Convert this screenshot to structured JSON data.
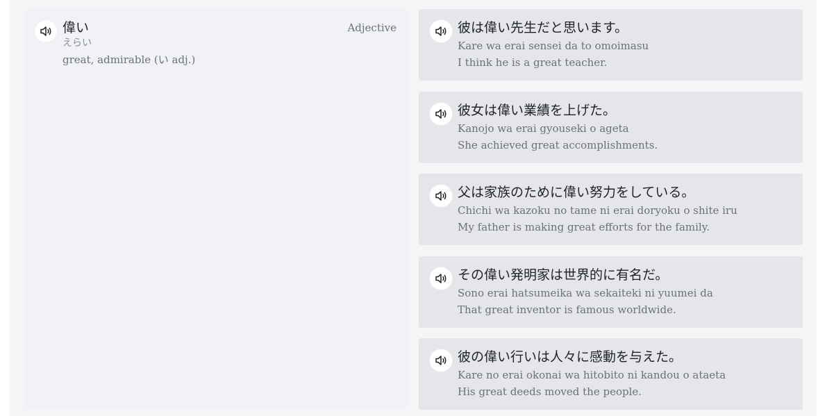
{
  "word": {
    "kanji": "偉い",
    "reading": "えらい",
    "meaning": "great, admirable (い adj.)",
    "part_of_speech": "Adjective",
    "audio_icon": "speaker-icon"
  },
  "examples": [
    {
      "japanese": "彼は偉い先生だと思います。",
      "romaji": "Kare wa erai sensei da to omoimasu",
      "english": "I think he is a great teacher."
    },
    {
      "japanese": "彼女は偉い業績を上げた。",
      "romaji": "Kanojo wa erai gyouseki o ageta",
      "english": "She achieved great accomplishments."
    },
    {
      "japanese": "父は家族のために偉い努力をしている。",
      "romaji": "Chichi wa kazoku no tame ni erai doryoku o shite iru",
      "english": "My father is making great efforts for the family."
    },
    {
      "japanese": "その偉い発明家は世界的に有名だ。",
      "romaji": "Sono erai hatsumeika wa sekaiteki ni yuumei da",
      "english": "That great inventor is famous worldwide."
    },
    {
      "japanese": "彼の偉い行いは人々に感動を与えた。",
      "romaji": "Kare no erai okonai wa hitobito ni kandou o ataeta",
      "english": "His great deeds moved the people."
    }
  ]
}
